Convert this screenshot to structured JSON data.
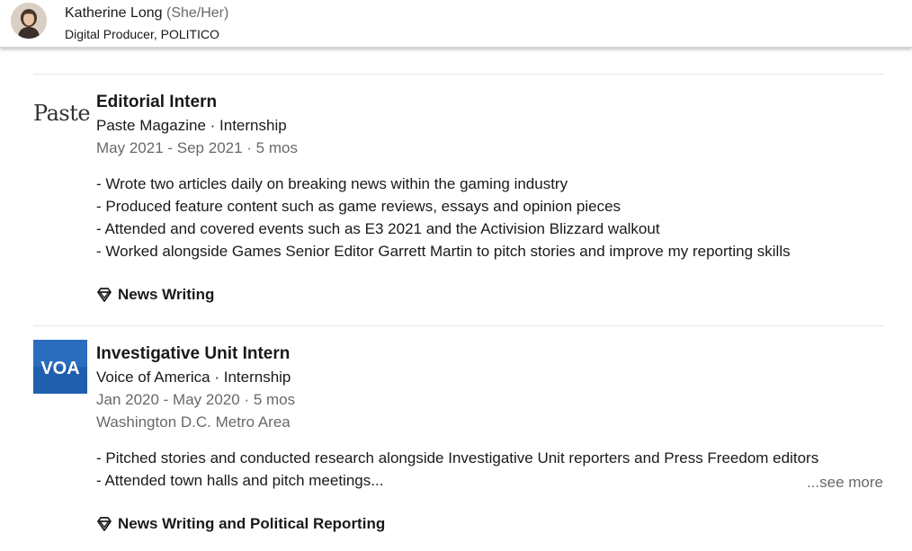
{
  "header": {
    "name": "Katherine Long",
    "pronouns": "(She/Her)",
    "headline": "Digital Producer, POLITICO"
  },
  "experiences": [
    {
      "logo_text": "Paste",
      "title": "Editorial Intern",
      "company_line": "Paste Magazine · Internship",
      "dates": "May 2021 - Sep 2021 · 5 mos",
      "description": [
        "- Wrote two articles daily on breaking news within the gaming industry",
        "- Produced feature content such as game reviews, essays and opinion pieces",
        "- Attended and covered events such as E3 2021 and the Activision Blizzard walkout",
        "- Worked alongside Games Senior Editor Garrett Martin to pitch stories and improve my reporting skills"
      ],
      "skills": "News Writing"
    },
    {
      "logo_text": "VOA",
      "title": "Investigative Unit Intern",
      "company_line": "Voice of America · Internship",
      "dates": "Jan 2020 - May 2020 · 5 mos",
      "location": "Washington D.C. Metro Area",
      "description": [
        "- Pitched stories and conducted research alongside Investigative Unit reporters and Press Freedom editors",
        "- Attended town halls and pitch meetings..."
      ],
      "see_more": "...see more",
      "skills": "News Writing and Political Reporting"
    }
  ],
  "icons": {
    "skill": "diamond-icon",
    "avatar": "profile-photo"
  },
  "colors": {
    "voa_blue": "#1f5fad",
    "muted_text": "#666666"
  }
}
